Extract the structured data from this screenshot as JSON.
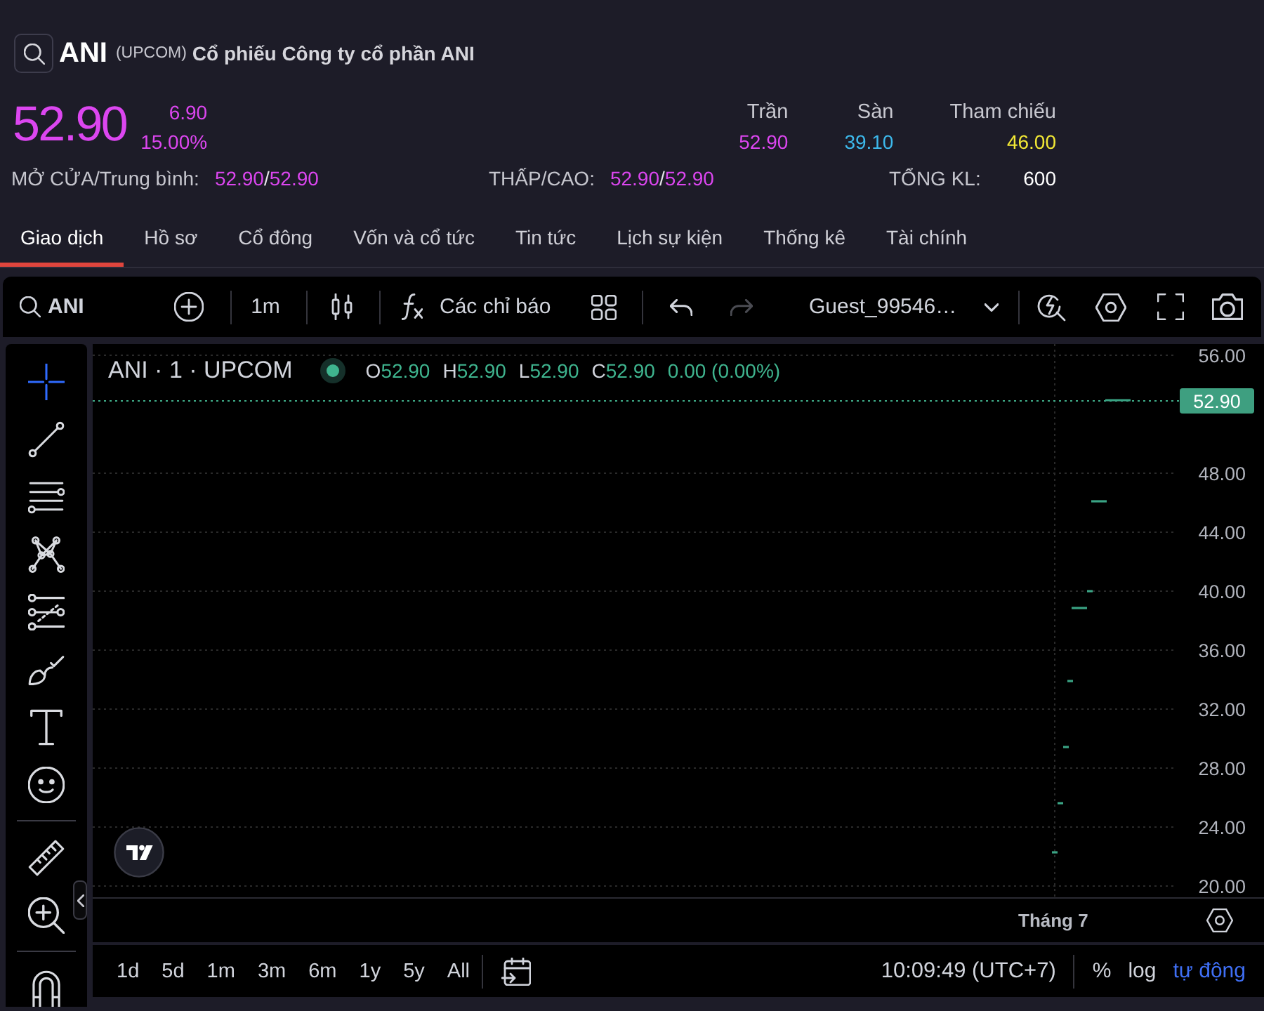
{
  "header": {
    "symbol": "ANI",
    "exchange": "(UPCOM)",
    "company": "Cổ phiếu Công ty cổ phần ANI"
  },
  "quote": {
    "price": "52.90",
    "change": "6.90",
    "change_percent": "15.00%",
    "reference_prices": [
      {
        "label": "Trần",
        "value": "52.90",
        "color": "#dc46f0"
      },
      {
        "label": "Sàn",
        "value": "39.10",
        "color": "#3db9ec"
      },
      {
        "label": "Tham chiếu",
        "value": "46.00",
        "color": "#f2e835"
      }
    ],
    "stats": [
      {
        "kind": "price_pair",
        "label": "MỞ CỬA/Trung bình:",
        "values": [
          "52.90",
          "52.90"
        ],
        "separator": "/"
      },
      {
        "kind": "price_pair",
        "label": "THẤP/CAO:",
        "values": [
          "52.90",
          "52.90"
        ],
        "separator": "/"
      },
      {
        "kind": "volume",
        "label": "TỔNG KL:",
        "values": [
          "600"
        ]
      }
    ]
  },
  "tabs": [
    {
      "label": "Giao dịch",
      "selected": true
    },
    {
      "label": "Hồ sơ",
      "selected": false
    },
    {
      "label": "Cổ đông",
      "selected": false
    },
    {
      "label": "Vốn và cổ tức",
      "selected": false
    },
    {
      "label": "Tin tức",
      "selected": false
    },
    {
      "label": "Lịch sự kiện",
      "selected": false
    },
    {
      "label": "Thống kê",
      "selected": false
    },
    {
      "label": "Tài chính",
      "selected": false
    }
  ],
  "chart_toolbar": {
    "symbol": "ANI",
    "interval": "1m",
    "indicators": "Các chỉ báo",
    "undo": {
      "disabled": false
    },
    "redo": {
      "disabled": true
    },
    "layout": "Guest_99546…"
  },
  "drawing_tools": {
    "groups": [
      {
        "tools": [
          {
            "kind": "crosshair",
            "selected": true
          },
          {
            "kind": "trend_line",
            "selected": false
          },
          {
            "kind": "parallel_lines",
            "selected": false
          },
          {
            "kind": "pattern",
            "selected": false
          },
          {
            "kind": "fib_levels",
            "selected": false
          },
          {
            "kind": "brush",
            "selected": false
          },
          {
            "kind": "text",
            "selected": false
          },
          {
            "kind": "emoji",
            "selected": false
          }
        ]
      },
      {
        "tools": [
          {
            "kind": "ruler",
            "selected": false
          },
          {
            "kind": "zoom",
            "selected": false
          }
        ]
      },
      {
        "tools": [
          {
            "kind": "magnet",
            "selected": false
          }
        ]
      }
    ]
  },
  "chart": {
    "legend": {
      "title": "ANI · 1 · UPCOM",
      "ohlc": [
        {
          "label": "O",
          "value": "52.90"
        },
        {
          "label": "H",
          "value": "52.90"
        },
        {
          "label": "L",
          "value": "52.90"
        },
        {
          "label": "C",
          "value": "52.90"
        }
      ],
      "change": "0.00 (0.00%)"
    },
    "price_axis": {
      "labels": [
        "56.00",
        "48.00",
        "44.00",
        "40.00",
        "36.00",
        "32.00",
        "28.00",
        "24.00",
        "20.00"
      ]
    },
    "last_price": "52.90",
    "time_axis": {
      "labels": [
        "Tháng 7"
      ]
    }
  },
  "bottom_bar": {
    "ranges": [
      "1d",
      "5d",
      "1m",
      "3m",
      "6m",
      "1y",
      "5y",
      "All"
    ],
    "clock": "10:09:49 (UTC+7)",
    "scale_options": [
      {
        "label": "%",
        "selected": false
      },
      {
        "label": "log",
        "selected": false
      },
      {
        "label": "tự động",
        "selected": true
      }
    ]
  }
}
